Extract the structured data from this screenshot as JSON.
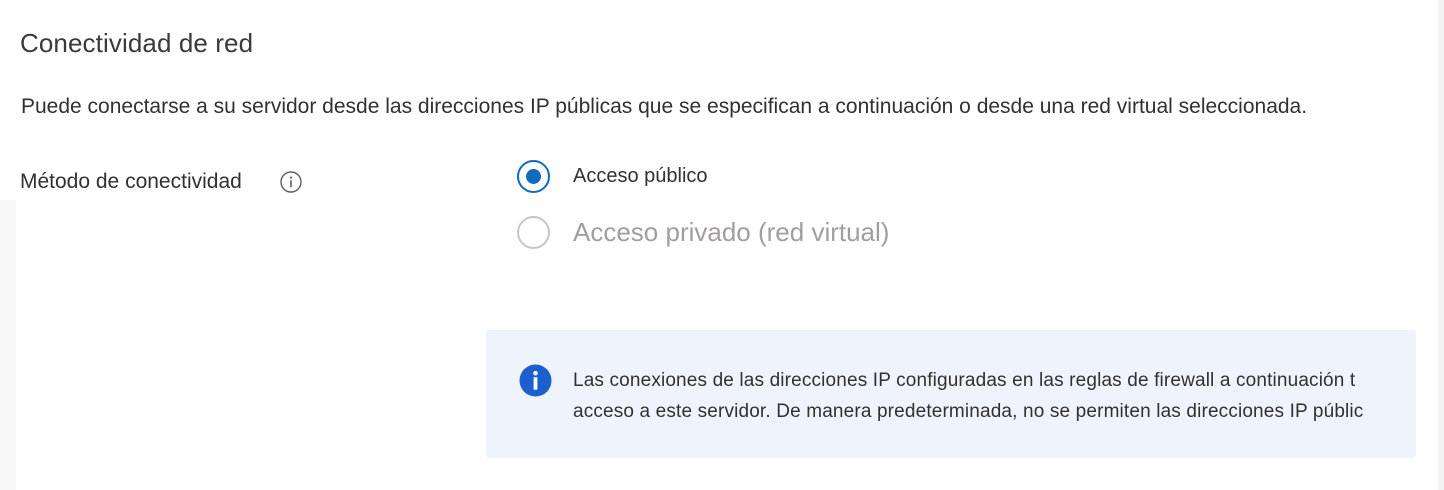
{
  "section": {
    "title": "Conectividad de red",
    "description": "Puede conectarse a su servidor desde las direcciones IP públicas que se especifican a continuación o desde una red virtual seleccionada."
  },
  "connectivity": {
    "label": "Método de conectividad",
    "info_icon": "info-circle-icon",
    "options": [
      {
        "label": "Acceso público",
        "selected": true,
        "disabled": false
      },
      {
        "label": "Acceso privado (red virtual)",
        "selected": false,
        "disabled": true
      }
    ]
  },
  "info_box": {
    "icon": "info-filled-icon",
    "line1": "Las conexiones de las direcciones IP configuradas en las reglas de firewall a continuación t",
    "line2": "acceso a este servidor. De manera predeterminada, no se permiten las direcciones IP públic"
  },
  "colors": {
    "accent": "#0f6cbd",
    "info_background": "#eff4fc",
    "disabled": "#a19f9d",
    "text": "#323130"
  }
}
